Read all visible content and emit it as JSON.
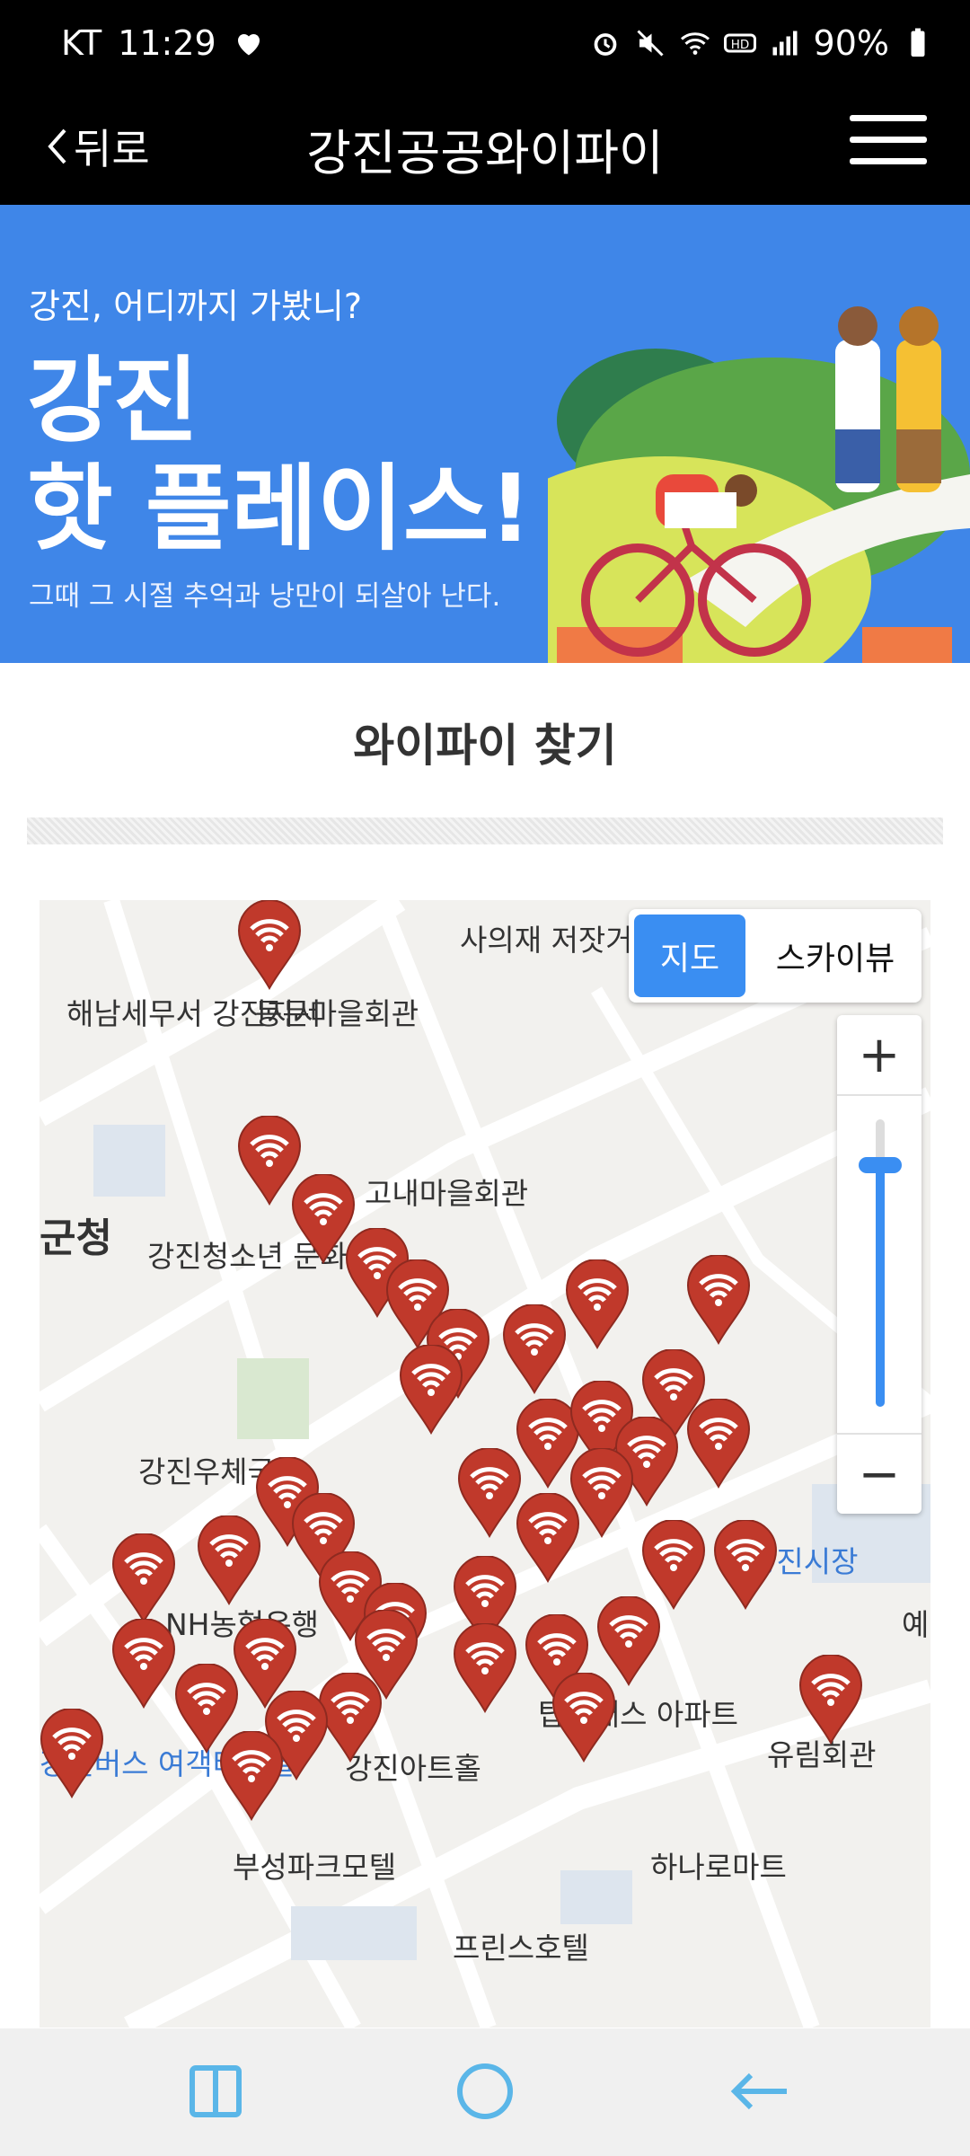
{
  "status": {
    "carrier": "KT",
    "time": "11:29",
    "battery": "90%",
    "icons": [
      "heart-icon",
      "alarm-icon",
      "mute-icon",
      "wifi-icon",
      "hd-icon",
      "signal-icon",
      "battery-icon"
    ]
  },
  "appbar": {
    "back_label": "뒤로",
    "title": "강진공공와이파이",
    "menu_icon": "hamburger-menu-icon"
  },
  "banner": {
    "subtitle": "강진, 어디까지 가봤니?",
    "headline_line1": "강진",
    "headline_line2": "핫 플레이스!",
    "description": "그때 그 시절 추억과 낭만이 되살아 난다."
  },
  "section": {
    "title": "와이파이 찾기"
  },
  "map": {
    "toggle": {
      "map_label": "지도",
      "sky_label": "스카이뷰",
      "selected": "지도"
    },
    "zoom": {
      "plus_label": "+",
      "minus_label": "−",
      "level": 0.84
    },
    "labels": [
      "사의재 저잣거리",
      "동문마을회관",
      "해남세무서 강진지서",
      "고내마을회관",
      "군청",
      "강진청소년 문화의집",
      "강진우체국",
      "NH농협은행",
      "강진시장",
      "예",
      "탑클래스 아파트",
      "유림회관",
      "강진아트홀",
      "강진버스 여객터미널",
      "부성파크모텔",
      "하나로마트",
      "프린스호텔"
    ],
    "marker_icon": "wifi-marker-icon",
    "colors": {
      "marker": "#c0392b",
      "road": "#ffffff",
      "land": "#f2f1ee",
      "accent": "#3a8ef2"
    }
  },
  "navbar": {
    "icons": [
      "recent-apps-icon",
      "home-icon",
      "back-arrow-icon"
    ]
  }
}
